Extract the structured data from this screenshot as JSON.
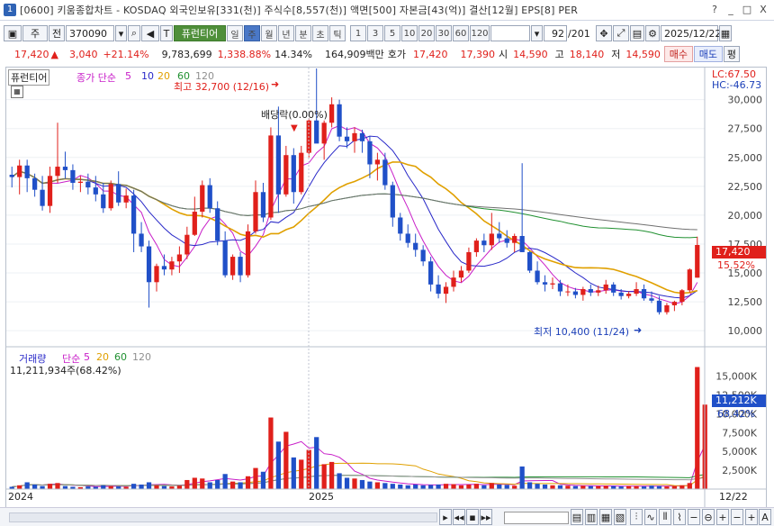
{
  "window": {
    "number": "1",
    "title": "[0600] 키움종합차트 - KOSDAQ 외국인보유[331(천)] 주식수[8,557(천)] 액면[500] 자본금[43(억)] 결산[12월] EPS[8] PER",
    "controls": [
      "?",
      "_",
      "□",
      "X"
    ]
  },
  "toolbar": {
    "type_label": "주",
    "jeon_label": "전",
    "code": "370090",
    "name_label": "퓨런티어",
    "periods": [
      "일",
      "주",
      "월",
      "년",
      "분",
      "초",
      "틱"
    ],
    "selected_period": "주",
    "intervals": [
      "1",
      "3",
      "5",
      "10",
      "20",
      "30",
      "60",
      "120"
    ],
    "page_count": "92",
    "page_total": "/201",
    "date": "2025/12/22"
  },
  "info": {
    "price": "17,420",
    "change": "3,040",
    "change_pct": "+21.14%",
    "volume": "9,783,699",
    "volume_pct": "1,338.88%",
    "turnover": "14.34%",
    "amount": "164,909백만",
    "quote_label": "호가",
    "bid": "17,420",
    "ask": "17,390",
    "open_label": "시",
    "open": "14,590",
    "high_label": "고",
    "high": "18,140",
    "low_label": "저",
    "low": "14,590",
    "buy": "매수",
    "sell": "매도",
    "eval": "평"
  },
  "price_panel": {
    "name": "퓨런티어",
    "ma_label": "종가 단순",
    "ma_periods": [
      "5",
      "10",
      "20",
      "60",
      "120"
    ],
    "ma_colors": [
      "#c81ec8",
      "#2828c8",
      "#e0a000",
      "#209030",
      "#707070"
    ],
    "lc": "LC:67.50",
    "hc": "HC:-46.73",
    "high_annot": "최고 32,700 (12/16)",
    "low_annot": "최저 10,400 (11/24)",
    "dividend": "배당락(0.00%)",
    "last_price": "17,420",
    "last_pct": "15.52%"
  },
  "volume_panel": {
    "title": "거래량",
    "ma_label": "단순",
    "ma_periods": [
      "5",
      "20",
      "60",
      "120"
    ],
    "current": "11,211,934주(68.42%)",
    "last": "11,212K",
    "last_pct": "68.42%"
  },
  "x_axis": {
    "labels": [
      "2024",
      "2025"
    ],
    "end_label": "12/22"
  },
  "chart_data": {
    "type": "bar",
    "price": {
      "ticks": [
        "30,000",
        "27,500",
        "25,000",
        "22,500",
        "20,000",
        "17,500",
        "15,000",
        "12,500",
        "10,000"
      ],
      "tick_values": [
        30000,
        27500,
        25000,
        22500,
        20000,
        17500,
        15000,
        12500,
        10000
      ],
      "ylim": [
        9000,
        32000
      ],
      "ohlc": [
        [
          23500,
          24200,
          22400,
          23300
        ],
        [
          23300,
          24800,
          21800,
          24300
        ],
        [
          24300,
          24800,
          22000,
          23200
        ],
        [
          23200,
          23600,
          21600,
          22200
        ],
        [
          22200,
          23400,
          20400,
          20800
        ],
        [
          20800,
          24200,
          20200,
          23400
        ],
        [
          23400,
          28000,
          22800,
          24200
        ],
        [
          24200,
          25500,
          23200,
          23900
        ],
        [
          23900,
          24400,
          22200,
          22800
        ],
        [
          22800,
          23400,
          22000,
          22900
        ],
        [
          22900,
          23600,
          21800,
          22400
        ],
        [
          22400,
          23400,
          21200,
          21800
        ],
        [
          21800,
          22800,
          20200,
          20600
        ],
        [
          20600,
          23000,
          20400,
          22700
        ],
        [
          22700,
          23800,
          20800,
          21100
        ],
        [
          21100,
          22300,
          20600,
          21700
        ],
        [
          21700,
          22200,
          16800,
          18400
        ],
        [
          18400,
          19400,
          16800,
          17300
        ],
        [
          17300,
          17800,
          12000,
          14200
        ],
        [
          14200,
          15800,
          13400,
          15600
        ],
        [
          15600,
          16600,
          14800,
          15300
        ],
        [
          15300,
          16400,
          14800,
          16000
        ],
        [
          16000,
          17300,
          15000,
          16600
        ],
        [
          16600,
          19000,
          16200,
          18300
        ],
        [
          18300,
          21600,
          18200,
          20300
        ],
        [
          20300,
          23000,
          19800,
          22600
        ],
        [
          22600,
          23200,
          20200,
          20600
        ],
        [
          20600,
          21200,
          17400,
          17800
        ],
        [
          17800,
          18600,
          14600,
          14800
        ],
        [
          14800,
          16600,
          14400,
          16400
        ],
        [
          16400,
          16800,
          14200,
          14800
        ],
        [
          14800,
          19200,
          14600,
          18600
        ],
        [
          18600,
          23000,
          18400,
          22000
        ],
        [
          22000,
          22800,
          19400,
          19800
        ],
        [
          19800,
          27600,
          19600,
          26900
        ],
        [
          26900,
          29400,
          20200,
          21800
        ],
        [
          21800,
          26000,
          21600,
          25200
        ],
        [
          25200,
          25800,
          21000,
          22000
        ],
        [
          22000,
          26000,
          21800,
          25400
        ],
        [
          25400,
          28400,
          25000,
          28200
        ],
        [
          28200,
          32700,
          27200,
          26200
        ],
        [
          26200,
          28200,
          24800,
          28000
        ],
        [
          28000,
          30200,
          27600,
          29600
        ],
        [
          29600,
          30000,
          26400,
          26800
        ],
        [
          26800,
          27600,
          25800,
          26400
        ],
        [
          26400,
          27600,
          25400,
          27100
        ],
        [
          27100,
          27400,
          25400,
          26400
        ],
        [
          26400,
          26800,
          23200,
          24400
        ],
        [
          24400,
          25400,
          23000,
          24800
        ],
        [
          24800,
          25400,
          22200,
          22600
        ],
        [
          22600,
          22900,
          19000,
          19800
        ],
        [
          19800,
          20200,
          17800,
          18400
        ],
        [
          18400,
          19200,
          17200,
          17600
        ],
        [
          17600,
          18400,
          16400,
          17000
        ],
        [
          17000,
          17400,
          15600,
          16000
        ],
        [
          16000,
          16400,
          13400,
          14000
        ],
        [
          14000,
          14800,
          12800,
          13200
        ],
        [
          13200,
          14200,
          12400,
          13800
        ],
        [
          13800,
          15200,
          13400,
          14600
        ],
        [
          14600,
          15600,
          14200,
          15200
        ],
        [
          15200,
          17200,
          15000,
          16800
        ],
        [
          16800,
          18000,
          16400,
          17800
        ],
        [
          17800,
          18400,
          16800,
          17400
        ],
        [
          17400,
          20200,
          17000,
          18400
        ],
        [
          18400,
          19400,
          17600,
          18000
        ],
        [
          18000,
          18700,
          17200,
          17600
        ],
        [
          17600,
          18400,
          16800,
          18200
        ],
        [
          18200,
          24500,
          17800,
          16800
        ],
        [
          16800,
          16900,
          15000,
          15200
        ],
        [
          15200,
          16000,
          14000,
          14200
        ],
        [
          14200,
          14800,
          13400,
          14000
        ],
        [
          14000,
          14600,
          13600,
          14100
        ],
        [
          14100,
          14400,
          13000,
          13400
        ],
        [
          13400,
          14000,
          13000,
          13400
        ],
        [
          13400,
          13700,
          12800,
          13100
        ],
        [
          13100,
          13800,
          12600,
          13600
        ],
        [
          13600,
          14000,
          13000,
          13300
        ],
        [
          13300,
          13900,
          13000,
          13500
        ],
        [
          13500,
          14400,
          13200,
          14000
        ],
        [
          14000,
          14200,
          13000,
          13300
        ],
        [
          13300,
          13600,
          12700,
          13000
        ],
        [
          13000,
          13400,
          12800,
          13200
        ],
        [
          13200,
          14200,
          13000,
          13600
        ],
        [
          13600,
          14000,
          12600,
          12800
        ],
        [
          12800,
          13400,
          12400,
          12600
        ],
        [
          12600,
          13000,
          11400,
          11600
        ],
        [
          11600,
          12400,
          11400,
          12200
        ],
        [
          12200,
          12600,
          11700,
          12500
        ],
        [
          12500,
          13600,
          12200,
          13500
        ],
        [
          13500,
          15400,
          13300,
          15300
        ],
        [
          14590,
          18140,
          14590,
          17420
        ]
      ]
    },
    "volume": {
      "ticks": [
        "15,000K",
        "12,500K",
        "10,000K",
        "7,500K",
        "5,000K",
        "2,500K"
      ],
      "tick_values": [
        15000,
        12500,
        10000,
        7500,
        5000,
        2500
      ],
      "ylim": [
        0,
        16500
      ],
      "values_k": [
        300,
        500,
        900,
        600,
        400,
        700,
        800,
        400,
        300,
        250,
        350,
        300,
        500,
        400,
        350,
        300,
        700,
        600,
        900,
        500,
        400,
        350,
        450,
        1200,
        1500,
        1400,
        900,
        1200,
        2000,
        1000,
        900,
        1700,
        2800,
        2300,
        9500,
        6300,
        7600,
        4200,
        3900,
        5200,
        6900,
        3300,
        3600,
        2100,
        1500,
        1400,
        1200,
        1000,
        900,
        800,
        700,
        600,
        500,
        600,
        500,
        550,
        600,
        700,
        650,
        500,
        600,
        700,
        500,
        800,
        600,
        550,
        450,
        3000,
        900,
        700,
        600,
        500,
        500,
        450,
        400,
        450,
        400,
        400,
        450,
        400,
        350,
        400,
        400,
        350,
        450,
        400,
        350,
        400,
        500,
        800,
        16200,
        11212
      ]
    }
  }
}
